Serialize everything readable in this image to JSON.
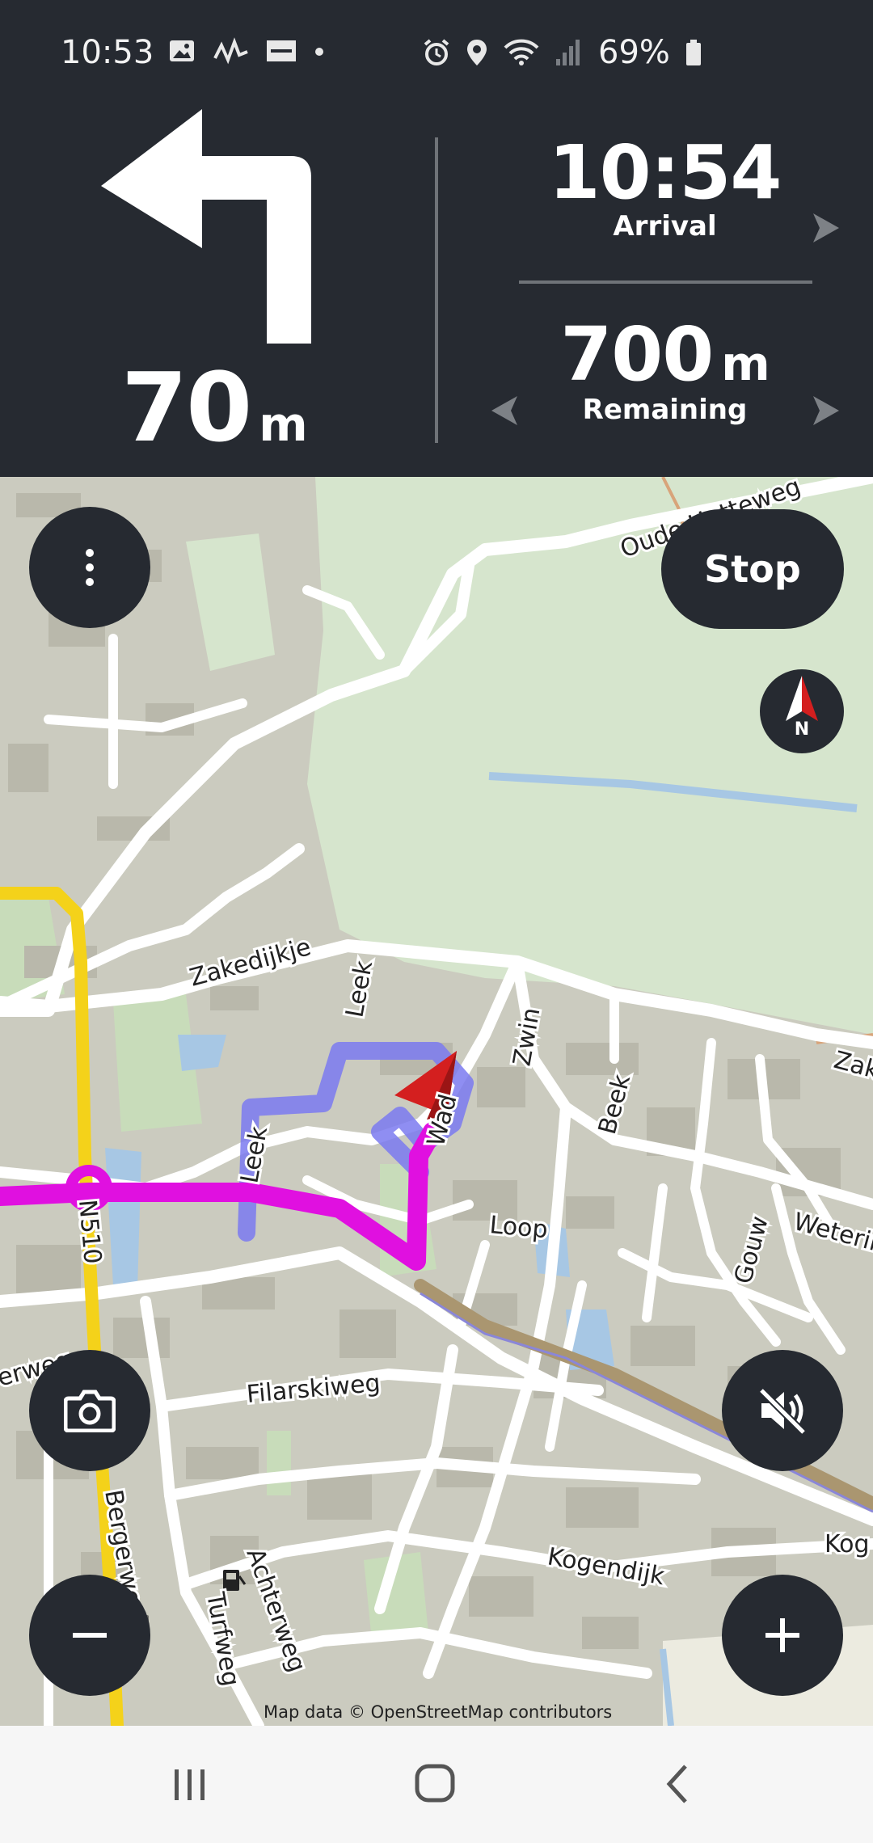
{
  "status_bar": {
    "time": "10:53",
    "left_icons": [
      "image-icon",
      "activity-icon",
      "sonos-icon",
      "dot-icon"
    ],
    "right_icons": [
      "alarm-icon",
      "location-icon",
      "wifi-icon",
      "signal-icon",
      "battery-icon"
    ],
    "battery": "69%"
  },
  "guidance": {
    "maneuver_icon": "turn-left-arrow-icon",
    "distance_value": "70",
    "distance_unit": "m",
    "arrival_time": "10:54",
    "arrival_label": "Arrival",
    "remaining_value": "700",
    "remaining_unit": "m",
    "remaining_label": "Remaining"
  },
  "map": {
    "street_labels": [
      "Oude Hatteweg",
      "Zakedijkje",
      "Leek",
      "Zwin",
      "Beek",
      "Wad",
      "Loop",
      "N510",
      "Filarskiweg",
      "Bergerweg",
      "Achterweg",
      "Turfweg",
      "Kogendijk",
      "Gouw",
      "Wetering",
      "Zak",
      "Kog",
      "erweg"
    ],
    "attribution": "Map data © OpenStreetMap contributors",
    "route_colors": {
      "route": "#e010e0",
      "traveled": "#6d6cf0",
      "highway": "#f4d21a"
    }
  },
  "controls": {
    "menu_icon": "more-vertical-icon",
    "stop_label": "Stop",
    "compass_label": "N",
    "camera_icon": "camera-icon",
    "mute_icon": "volume-muted-icon",
    "zoom_out_icon": "minus-icon",
    "zoom_in_icon": "plus-icon"
  },
  "system_nav": [
    "recent-apps-icon",
    "home-icon",
    "back-icon"
  ]
}
